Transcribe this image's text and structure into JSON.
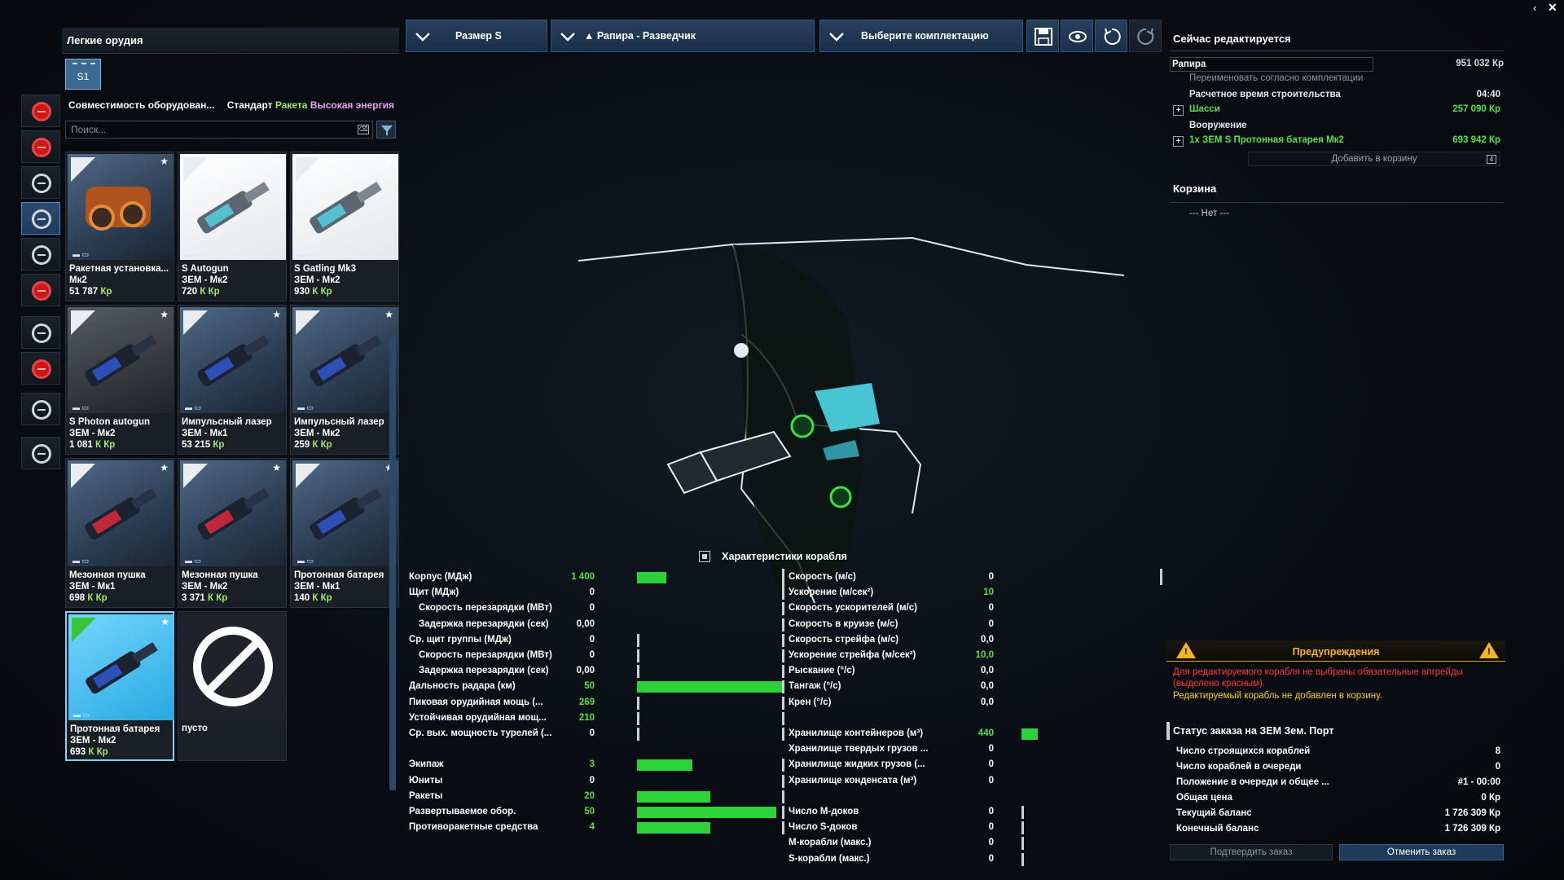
{
  "left": {
    "header": "Легкие орудия",
    "slot_tab": "S1",
    "compat_label": "Совместимость оборудован...",
    "compat_standard": "Стандарт",
    "compat_rocket": "Ракета",
    "compat_energy": "Высокая энергия",
    "search_placeholder": "Поиск...",
    "search_clear": "⌫"
  },
  "items": [
    {
      "line1": "Ракетная установка...",
      "line2": "Мк2",
      "price": "51 787",
      "cur": "Кр",
      "style": "orange"
    },
    {
      "line1": "S Autogun",
      "line2": "ЗЕМ - Мк2",
      "price": "720",
      "cur": "К Кр",
      "style": "white"
    },
    {
      "line1": "S Gatling Mk3",
      "line2": "ЗЕМ - Мк2",
      "price": "930",
      "cur": "К Кр",
      "style": "white"
    },
    {
      "line1": "S Photon autogun",
      "line2": "ЗЕМ - Мк2",
      "price": "1 081",
      "cur": "К Кр",
      "style": "dark"
    },
    {
      "line1": "Импульсный лазер",
      "line2": "ЗЕМ - Мк1",
      "price": "53 215",
      "cur": "Кр",
      "style": "blue"
    },
    {
      "line1": "Импульсный лазер",
      "line2": "ЗЕМ - Мк2",
      "price": "259",
      "cur": "К Кр",
      "style": "blue"
    },
    {
      "line1": "Мезонная пушка",
      "line2": "ЗЕМ - Мк1",
      "price": "698",
      "cur": "К Кр",
      "style": "blue"
    },
    {
      "line1": "Мезонная пушка",
      "line2": "ЗЕМ - Мк2",
      "price": "3 371",
      "cur": "К Кр",
      "style": "blue"
    },
    {
      "line1": "Протонная батарея",
      "line2": "ЗЕМ - Мк1",
      "price": "140",
      "cur": "К Кр",
      "style": "blue"
    },
    {
      "line1": "Протонная батарея",
      "line2": "ЗЕМ - Мк2",
      "price": "693",
      "cur": "К Кр",
      "style": "selected"
    },
    {
      "line1": "пусто",
      "line2": "",
      "price": "",
      "cur": "",
      "style": "empty"
    }
  ],
  "toolbar": {
    "size": "Размер S",
    "ship": "▲ Рапира - Разведчик",
    "loadout": "Выберите комплектацию"
  },
  "right": {
    "title": "Сейчас редактируется",
    "ship_name": "Рапира",
    "ship_price": "951 032 Кр",
    "rename": "Переименовать согласно комплектации",
    "build_time_label": "Расчетное время строительства",
    "build_time": "04:40",
    "hull_label": "Шасси",
    "hull_price": "257 090 Кр",
    "weapons_label": "Вооружение",
    "weapon_item": "1x ЗЕМ S Протонная батарея Мк2",
    "weapon_price": "693 942 Кр",
    "add_cart": "Добавить в корзину",
    "add_cart_key": "4",
    "cart_title": "Корзина",
    "cart_empty": "--- Нет ---",
    "warn_title": "Предупреждения",
    "warn_red": "Для редактируемого корабля не выбраны обязательные апгрейды (выделено красным).",
    "warn_yellow": "Редактируемый корабль не добавлен в корзину.",
    "order_title": "Статус заказа на ЗЕМ Зем. Порт",
    "order_rows": [
      {
        "label": "Число строящихся кораблей",
        "value": "8"
      },
      {
        "label": "Число кораблей в очереди",
        "value": "0"
      },
      {
        "label": "Положение в очереди и общее ...",
        "value": "#1 - 00:00"
      },
      {
        "label": "Общая цена",
        "value": "0 Кр"
      },
      {
        "label": "Текущий баланс",
        "value": "1 726 309 Кр"
      },
      {
        "label": "Конечный баланс",
        "value": "1 726 309 Кр"
      }
    ],
    "confirm": "Подтвердить заказ",
    "cancel": "Отменить заказ"
  },
  "stats": {
    "title": "Характеристики корабля",
    "left": [
      {
        "label": "Корпус (МДж)",
        "value": "1 400",
        "green": true,
        "bar": 0.2,
        "ind": false
      },
      {
        "label": "Щит (МДж)",
        "value": "0",
        "bar": 0,
        "ind": false
      },
      {
        "label": "Скорость перезарядки (МВт)",
        "value": "0",
        "bar": 0,
        "ind": true
      },
      {
        "label": "Задержка перезарядки (сек)",
        "value": "0,00",
        "bar": 0,
        "ind": true
      },
      {
        "label": "Ср. щит группы (МДж)",
        "value": "0",
        "bar": 0,
        "tick": true,
        "ind": false
      },
      {
        "label": "Скорость перезарядки (МВт)",
        "value": "0",
        "bar": 0,
        "tick": true,
        "ind": true
      },
      {
        "label": "Задержка перезарядки (сек)",
        "value": "0,00",
        "bar": 0,
        "tick": true,
        "ind": true
      },
      {
        "label": "Дальность радара (км)",
        "value": "50",
        "green": true,
        "bar": 1.0,
        "ind": false
      },
      {
        "label": "Пиковая орудийная мощь (...",
        "value": "269",
        "green": true,
        "bar": 0.01,
        "tick": true,
        "ind": false
      },
      {
        "label": "Устойчивая орудийная мощ...",
        "value": "210",
        "green": true,
        "bar": 0.01,
        "tick": true,
        "ind": false
      },
      {
        "label": "Ср. вых. мощность турелей (...",
        "value": "0",
        "bar": 0,
        "tick": true,
        "ind": false
      },
      {
        "label": "",
        "value": "",
        "bar": 0,
        "ind": false
      },
      {
        "label": "Экипаж",
        "value": "3",
        "green": true,
        "bar": 0.38,
        "ind": false
      },
      {
        "label": "Юниты",
        "value": "0",
        "bar": 0,
        "ind": false
      },
      {
        "label": "Ракеты",
        "value": "20",
        "green": true,
        "bar": 0.5,
        "ind": false
      },
      {
        "label": "Развертываемое обор.",
        "value": "50",
        "green": true,
        "bar": 0.95,
        "ind": false
      },
      {
        "label": "Противоракетные средства",
        "value": "4",
        "green": true,
        "bar": 0.5,
        "ind": false
      }
    ],
    "right": [
      {
        "label": "Скорость (м/с)",
        "value": "0",
        "bar": 0
      },
      {
        "label": "Ускорение (м/сек²)",
        "value": "10",
        "green": true,
        "bar": 0
      },
      {
        "label": "Скорость ускорителей (м/с)",
        "value": "0",
        "bar": 0
      },
      {
        "label": "Скорость в круизе (м/с)",
        "value": "0",
        "bar": 0
      },
      {
        "label": "Скорость стрейфа (м/с)",
        "value": "0,0",
        "bar": 0
      },
      {
        "label": "Ускорение стрейфа (м/сек²)",
        "value": "10,0",
        "green": true,
        "bar": 0
      },
      {
        "label": "Рыскание (°/с)",
        "value": "0,0",
        "bar": 0
      },
      {
        "label": "Тангаж (°/с)",
        "value": "0,0",
        "bar": 0
      },
      {
        "label": "Крен (°/с)",
        "value": "0,0",
        "bar": 0
      },
      {
        "label": "",
        "value": "",
        "bar": 0
      },
      {
        "label": "Хранилище контейнеров (м³)",
        "value": "440",
        "green": true,
        "bar": 0.2
      },
      {
        "label": "Хранилище твердых грузов ...",
        "value": "0",
        "bar": 0
      },
      {
        "label": "Хранилище жидких грузов (...",
        "value": "0",
        "bar": 0
      },
      {
        "label": "Хранилище конденсата (м³)",
        "value": "0",
        "bar": 0
      },
      {
        "label": "",
        "value": "",
        "bar": 0
      },
      {
        "label": "Число М-доков",
        "value": "0",
        "bar": 0,
        "tick": true
      },
      {
        "label": "Число S-доков",
        "value": "0",
        "bar": 0,
        "tick": true
      },
      {
        "label": "М-корабли (макс.)",
        "value": "0",
        "bar": 0,
        "tick": true
      },
      {
        "label": "S-корабли (макс.)",
        "value": "0",
        "bar": 0,
        "tick": true
      }
    ]
  },
  "colors": {
    "accent": "#2dd23a",
    "warning": "#f4b324",
    "error": "#ff3838",
    "selection": "#7fd2ff"
  }
}
